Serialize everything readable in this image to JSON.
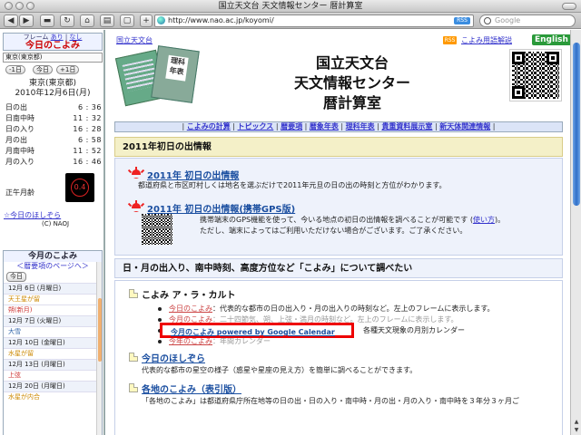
{
  "window": {
    "title": "国立天文台 天文情報センター 暦計算室"
  },
  "toolbar": {
    "url": "http://www.nao.ac.jp/koyomi/",
    "rss": "RSS",
    "search_placeholder": "Google"
  },
  "left": {
    "frame_label": "フレーム",
    "frame_on": "あり",
    "frame_off": "なし",
    "title": "今日のこよみ",
    "location_select": "東京(東京都)",
    "btn_prev": "-1日",
    "btn_today": "今日",
    "btn_next": "+1日",
    "place": "東京(東京都)",
    "date": "2010年12月6日(月)",
    "rows": [
      {
        "label": "日の出",
        "value": "6 : 36"
      },
      {
        "label": "日南中時",
        "value": "11 : 32"
      },
      {
        "label": "日の入り",
        "value": "16 : 28"
      },
      {
        "label": "月の出",
        "value": "6 : 58"
      },
      {
        "label": "月南中時",
        "value": "11 : 52"
      },
      {
        "label": "月の入り",
        "value": "16 : 46"
      }
    ],
    "moon_age_label": "正午月齢",
    "moon_age": "0.4",
    "hoshizora_link": "☆今日のほしぞら",
    "copyright": "(C) NAOJ",
    "cal_title": "今月のこよみ",
    "cal_link": "＜暦要項のページへ＞",
    "cal_today_btn": "今日",
    "cal_items": [
      {
        "text": "12月 6日 (月曜日)",
        "kind": "date"
      },
      {
        "text": "天王星が留",
        "kind": "ev"
      },
      {
        "text": "朔(新月)",
        "kind": "ev-red"
      },
      {
        "text": "12月 7日 (火曜日)",
        "kind": "date"
      },
      {
        "text": "大雪",
        "kind": "ev-blue"
      },
      {
        "text": "12月 10日 (金曜日)",
        "kind": "date"
      },
      {
        "text": "水星が留",
        "kind": "ev"
      },
      {
        "text": "12月 13日 (月曜日)",
        "kind": "date"
      },
      {
        "text": "上弦",
        "kind": "ev-red"
      },
      {
        "text": "12月 20日 (月曜日)",
        "kind": "date"
      },
      {
        "text": "水星が内合",
        "kind": "ev"
      }
    ]
  },
  "main": {
    "top_link": "国立天文台",
    "rss_badge": "RSS",
    "glossary": "こよみ用語解説",
    "english": "English",
    "book_label": "理科\n年表",
    "title_lines": [
      "国立天文台",
      "天文情報センター",
      "暦計算室"
    ],
    "nav": [
      "こよみの計算",
      "トピックス",
      "暦要項",
      "暦象年表",
      "理科年表",
      "貴重資料展示室",
      "新天体関連情報"
    ],
    "section1_head": "2011年初日の出情報",
    "item1_title": "2011年 初日の出情報",
    "item1_desc": "都道府県と市区町村しくは地名を選ぶだけで2011年元旦の日の出の時刻と方位がわかります。",
    "item2_title": "2011年 初日の出情報(携帯GPS版)",
    "item2_desc1_a": "携帯端末のGPS機能を使って、今いる地点の初日の出情報を調べることが可能です (",
    "item2_desc1_link": "使い方",
    "item2_desc1_b": ")。",
    "item2_desc2": "ただし、端末によってはご利用いただけない場合がございます。ご了承ください。",
    "section2_head": "日・月の出入り、南中時刻、高度方位など「こよみ」について調べたい",
    "alacarte": "こよみ ア・ラ・カルト",
    "bullets": [
      {
        "link": "今日のこよみ",
        "text": "：代表的な都市の日の出入り・月の出入りの時刻など。左上のフレームに表示します。"
      },
      {
        "link": "今月のこよみ",
        "text": "：二十四節気、朔、上弦・満月の時刻など。左上のフレームに表示します。"
      },
      {
        "link": "今月のこよみ powered by Google Calendar",
        "text": "各種天文現象の月別カレンダー"
      },
      {
        "link": "今年のこよみ",
        "text": "：年間カレンダー"
      }
    ],
    "hoshizora_title": "今日のほしぞら",
    "hoshizora_desc": "代表的な都市の星空の様子（惑星や星座の見え方）を簡単に調べることができます。",
    "kakuchi_title": "各地のこよみ（表引版）",
    "kakuchi_desc": "「各地のこよみ」は都道府県庁所在地等の日の出・日の入り・南中時・月の出・月の入り・南中時を３年分３ヶ月ご"
  }
}
